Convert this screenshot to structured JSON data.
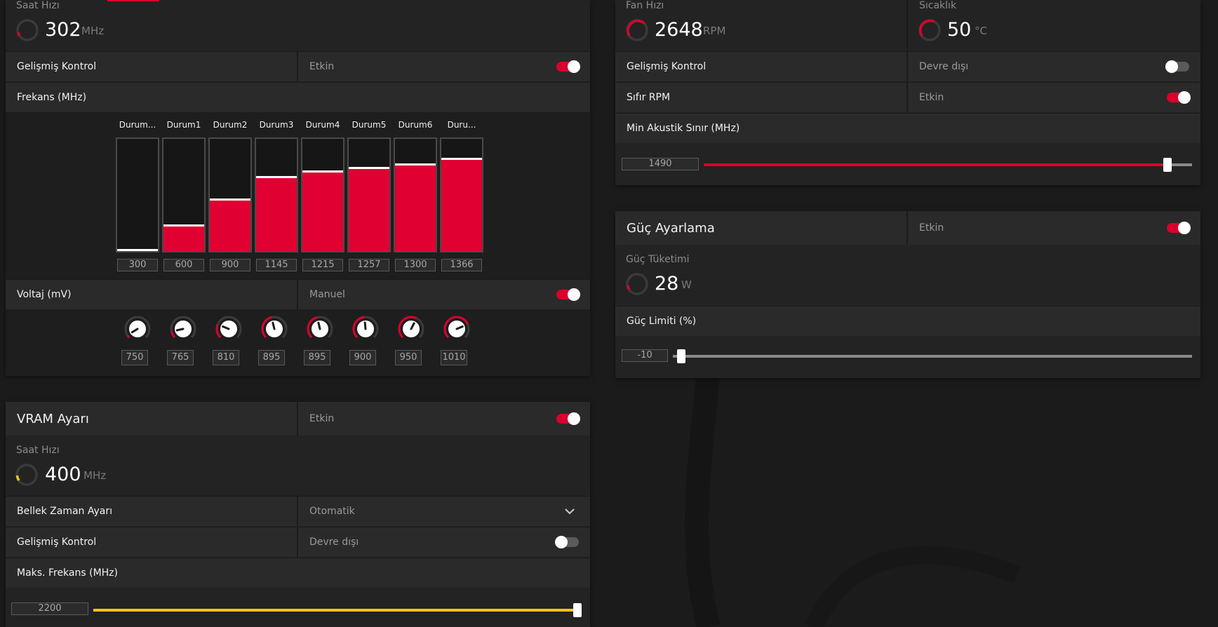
{
  "colors": {
    "accent": "#d9002c",
    "vram_accent": "#f5c518",
    "panel": "#232323",
    "row": "#2a2a2a"
  },
  "gpu": {
    "clock": {
      "label": "Saat Hızı",
      "value": "302",
      "unit": "MHz",
      "gauge_fraction": 0.1
    },
    "advanced": {
      "label": "Gelişmiş Kontrol",
      "value": "Etkin",
      "enabled": true
    },
    "freq": {
      "label": "Frekans (MHz)",
      "states": [
        {
          "name": "Durum...",
          "value": "300",
          "level": 0.0
        },
        {
          "name": "Durum1",
          "value": "600",
          "level": 0.24
        },
        {
          "name": "Durum2",
          "value": "900",
          "level": 0.47
        },
        {
          "name": "Durum3",
          "value": "1145",
          "level": 0.67
        },
        {
          "name": "Durum4",
          "value": "1215",
          "level": 0.72
        },
        {
          "name": "Durum5",
          "value": "1257",
          "level": 0.75
        },
        {
          "name": "Durum6",
          "value": "1300",
          "level": 0.78
        },
        {
          "name": "Duru...",
          "value": "1366",
          "level": 0.83
        }
      ]
    },
    "voltage": {
      "label": "Voltaj (mV)",
      "value": "Manuel",
      "enabled": true,
      "knobs": [
        {
          "value": "750",
          "level": 0.05
        },
        {
          "value": "765",
          "level": 0.12
        },
        {
          "value": "810",
          "level": 0.25
        },
        {
          "value": "895",
          "level": 0.45
        },
        {
          "value": "895",
          "level": 0.45
        },
        {
          "value": "900",
          "level": 0.48
        },
        {
          "value": "950",
          "level": 0.6
        },
        {
          "value": "1010",
          "level": 0.75
        }
      ]
    }
  },
  "vram": {
    "title": "VRAM Ayarı",
    "value": "Etkin",
    "enabled": true,
    "clock": {
      "label": "Saat Hızı",
      "value": "400",
      "unit": "MHz",
      "gauge_fraction": 0.12
    },
    "timing": {
      "label": "Bellek Zaman Ayarı",
      "value": "Otomatik"
    },
    "advanced": {
      "label": "Gelişmiş Kontrol",
      "value": "Devre dışı",
      "enabled": false
    },
    "max_freq": {
      "label": "Maks. Frekans (MHz)",
      "value": "2200",
      "fraction": 1.0
    }
  },
  "fan": {
    "speed": {
      "label": "Fan Hızı",
      "value": "2648",
      "unit": "RPM",
      "gauge_fraction": 0.55
    },
    "temp": {
      "label": "Sıcaklık",
      "value": "50",
      "unit": "°C",
      "gauge_fraction": 0.5
    },
    "advanced": {
      "label": "Gelişmiş Kontrol",
      "value": "Devre dışı",
      "enabled": false
    },
    "zero_rpm": {
      "label": "Sıfır RPM",
      "value": "Etkin",
      "enabled": true
    },
    "min_acoustic": {
      "label": "Min Akustik Sınır (MHz)",
      "value": "1490",
      "fraction": 0.95
    }
  },
  "power": {
    "title": "Güç Ayarlama",
    "value": "Etkin",
    "enabled": true,
    "consumption": {
      "label": "Güç Tüketimi",
      "value": "28",
      "unit": "W",
      "gauge_fraction": 0.1
    },
    "limit": {
      "label": "Güç Limiti (%)",
      "value": "-10",
      "fraction": 0.0
    }
  }
}
